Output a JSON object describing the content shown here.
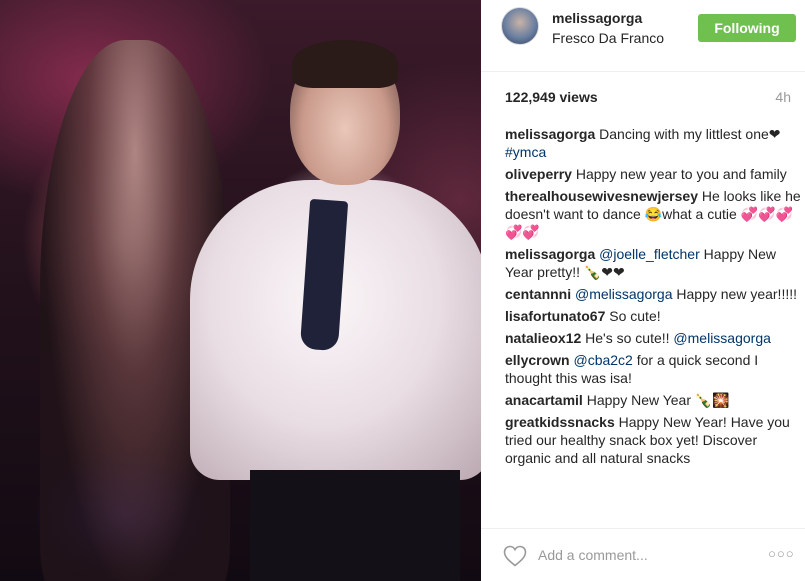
{
  "post": {
    "username": "melissagorga",
    "location": "Fresco Da Franco",
    "follow_label": "Following",
    "views": "122,949 views",
    "age": "4h"
  },
  "comments": [
    {
      "user": "melissagorga",
      "text": "Dancing with my littlest one❤ ",
      "tag": "#ymca"
    },
    {
      "user": "oliveperry",
      "text": "Happy new year to you and family"
    },
    {
      "user": "therealhousewivesnewjersey",
      "text": "He looks like he doesn't want to dance 😂what a cutie 💞💞💞💞💞"
    },
    {
      "user": "melissagorga",
      "mention": "@joelle_fletcher",
      "text": " Happy New Year pretty!! 🍾❤❤"
    },
    {
      "user": "centannni",
      "mention": "@melissagorga",
      "text": " Happy new year!!!!!"
    },
    {
      "user": "lisafortunato67",
      "text": "So cute!"
    },
    {
      "user": "natalieox12",
      "text": "He's so cute!! ",
      "mention2": "@melissagorga"
    },
    {
      "user": "ellycrown",
      "mention": "@cba2c2",
      "text": " for a quick second I thought this was isa!"
    },
    {
      "user": "anacartamil",
      "text": "Happy New Year 🍾🎇"
    },
    {
      "user": "greatkidssnacks",
      "text": "Happy New Year! Have you tried our healthy snack box yet! Discover organic and all natural snacks"
    }
  ],
  "footer": {
    "comment_placeholder": "Add a comment...",
    "more_label": "○○○",
    "icons": {
      "like": "heart-icon",
      "more": "more-options-icon"
    }
  },
  "colors": {
    "follow_button": "#70c050",
    "link": "#003569"
  }
}
